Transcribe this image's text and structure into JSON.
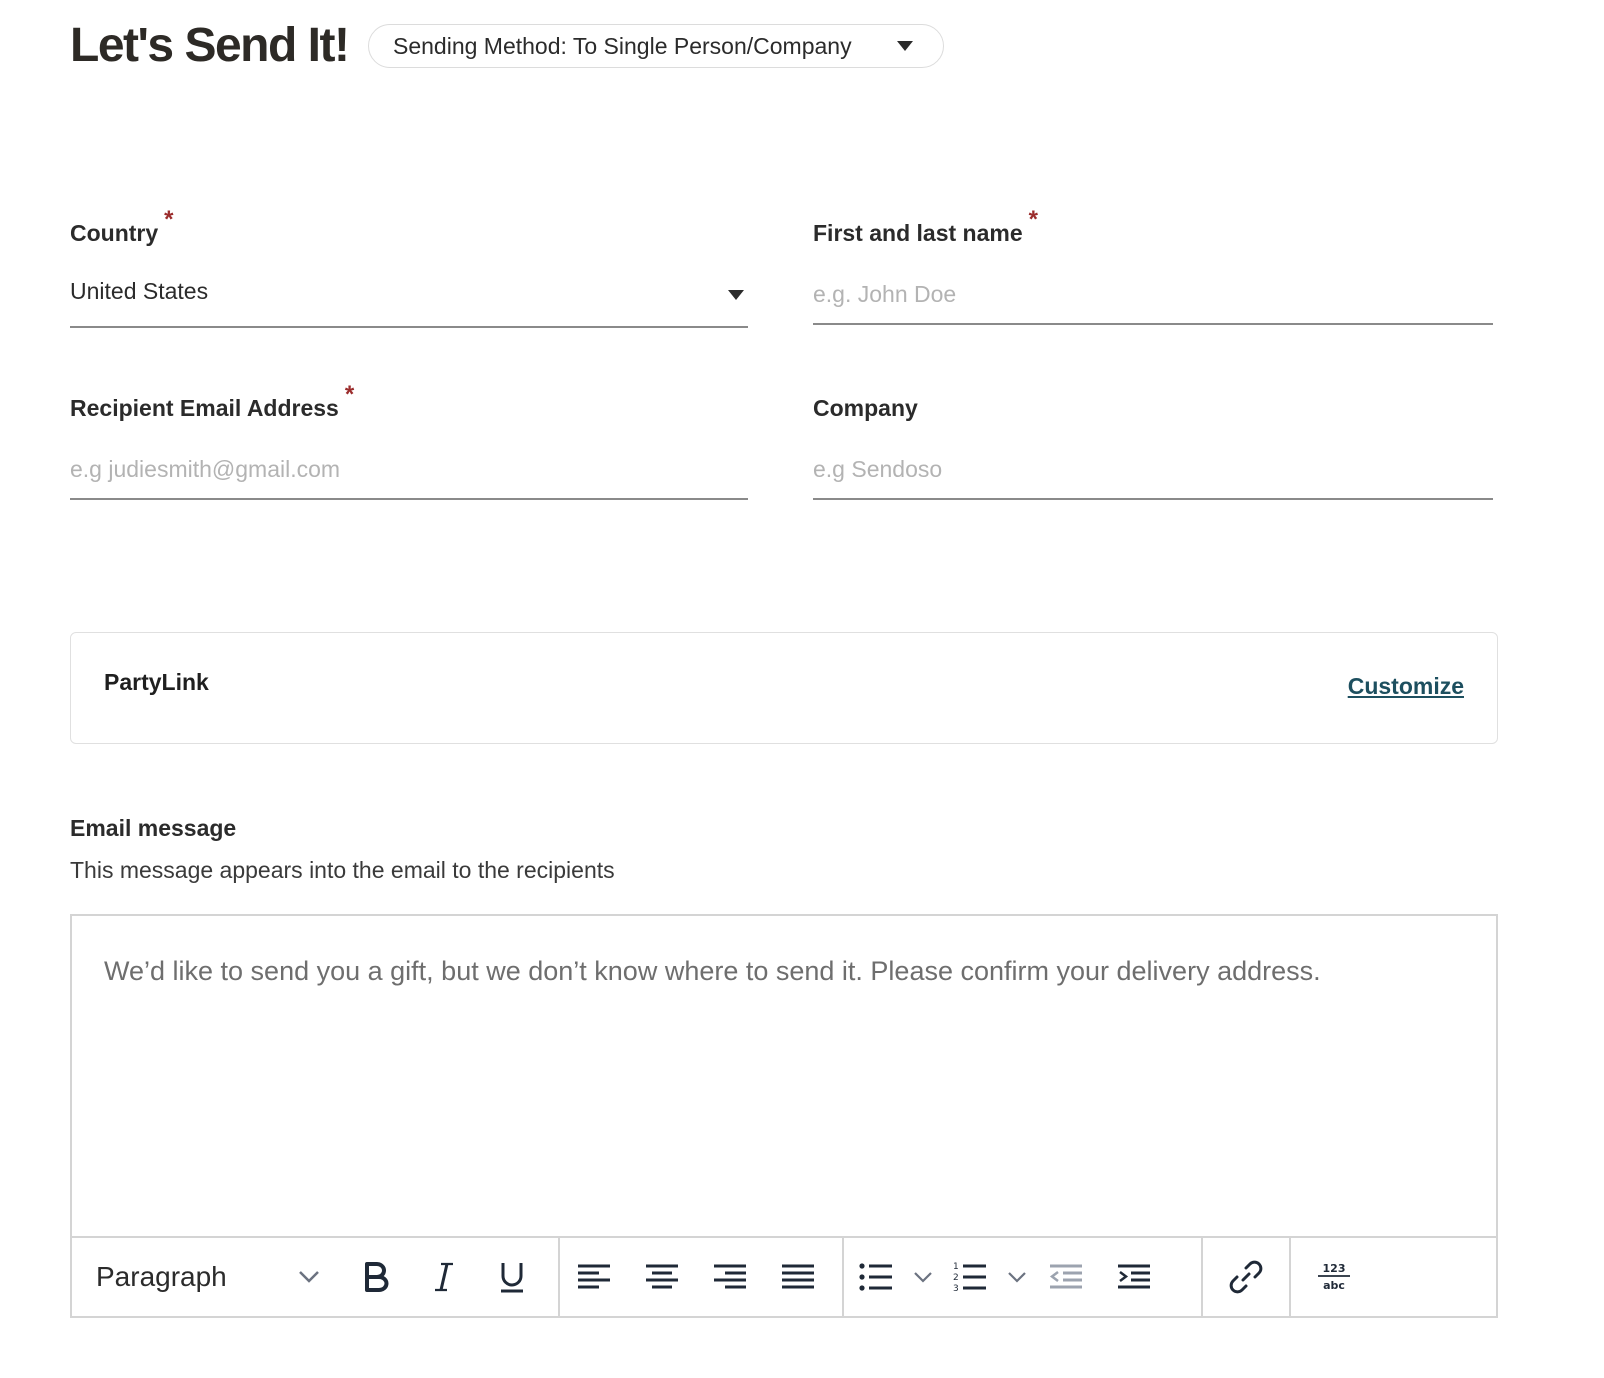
{
  "header": {
    "title": "Let's Send It!",
    "sending_method": "Sending Method: To Single Person/Company"
  },
  "form": {
    "country": {
      "label": "Country",
      "required_mark": "*",
      "value": "United States"
    },
    "name": {
      "label": "First and last name",
      "required_mark": "*",
      "placeholder": "e.g. John Doe",
      "value": ""
    },
    "email": {
      "label": "Recipient Email Address",
      "required_mark": "*",
      "placeholder": "e.g judiesmith@gmail.com",
      "value": ""
    },
    "company": {
      "label": "Company",
      "placeholder": "e.g Sendoso",
      "value": ""
    }
  },
  "party_card": {
    "name": "PartyLink",
    "customize_label": "Customize"
  },
  "email_message": {
    "title": "Email message",
    "subtitle": "This message appears into the email to the recipients",
    "body": "We’d like to send you a gift, but we don’t know where to send it. Please confirm your delivery address."
  },
  "toolbar": {
    "block_format": "Paragraph",
    "spellcheck_top": "123",
    "spellcheck_bottom": "abc"
  },
  "colors": {
    "required_star": "#9b2c2c",
    "link": "#1d4f5f",
    "input_underline": "#8a8a8a",
    "placeholder": "#b3b3b3",
    "border": "#d4d4d4"
  }
}
